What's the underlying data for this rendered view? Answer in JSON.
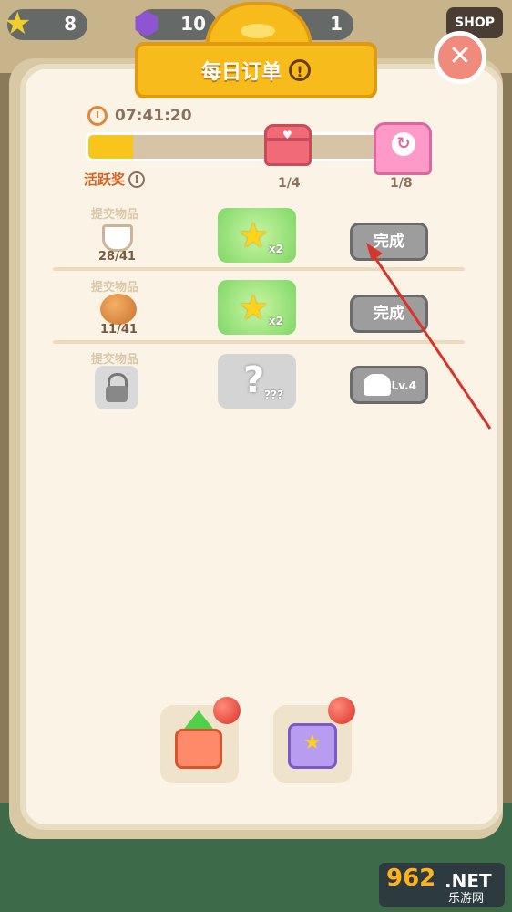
{
  "topbar": {
    "stars": "8",
    "gems": "10",
    "third": "1",
    "shop_label": "SHOP"
  },
  "header": {
    "title": "每日订单",
    "info": "!"
  },
  "close_label": "✕",
  "timer": "07:41:20",
  "progress": {
    "fraction": 0.13,
    "milestone1": "1/4",
    "milestone2": "1/8",
    "active_reward_label": "活跃奖"
  },
  "orders": [
    {
      "label": "提交物品",
      "count": "28/41",
      "reward_qty": "x2",
      "button": "完成"
    },
    {
      "label": "提交物品",
      "count": "11/41",
      "reward_qty": "x2",
      "button": "完成"
    },
    {
      "label": "提交物品",
      "reward_symbol": "?",
      "reward_qty": "???",
      "button": "Lv.4"
    }
  ],
  "watermark": {
    "num": "962",
    "net": ".NET",
    "sub": "乐游网"
  },
  "colors": {
    "accent": "#f7bb1c",
    "panel": "#fbf3e6",
    "arrow": "#d9342a"
  }
}
